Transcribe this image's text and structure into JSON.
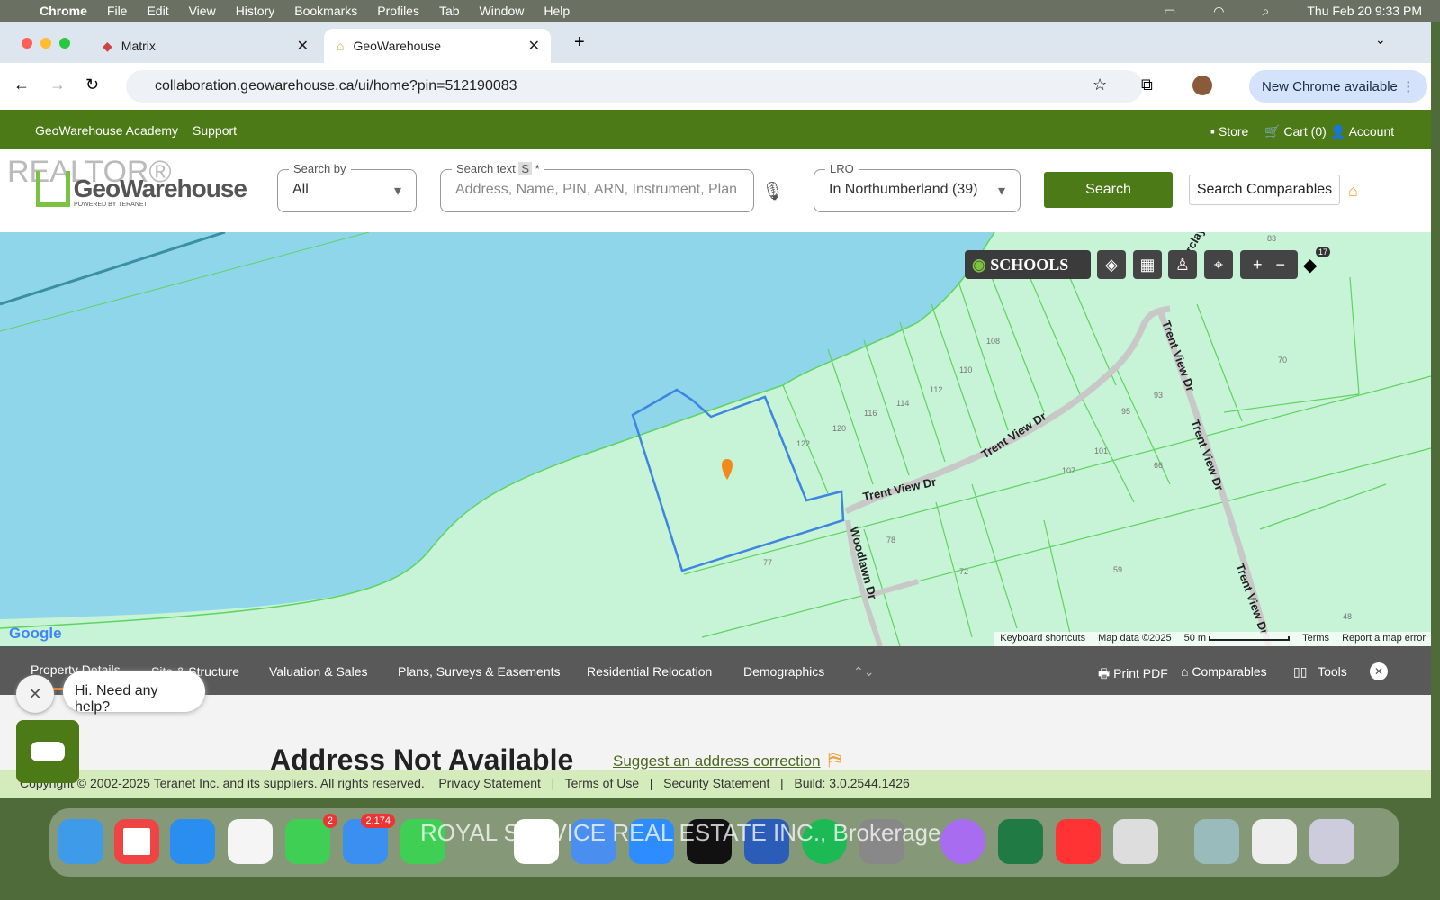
{
  "menubar": {
    "items": [
      "Chrome",
      "File",
      "Edit",
      "View",
      "History",
      "Bookmarks",
      "Profiles",
      "Tab",
      "Window",
      "Help"
    ],
    "datetime": "Thu Feb 20  9:33 PM"
  },
  "browser": {
    "tabs": [
      {
        "label": "Matrix"
      },
      {
        "label": "GeoWarehouse"
      }
    ],
    "url": "collaboration.geowarehouse.ca/ui/home?pin=512190083",
    "new_chrome": "New Chrome available"
  },
  "nav": {
    "left": [
      "GeoWarehouse Academy",
      "Support"
    ],
    "store": "Store",
    "cart": "Cart (0)",
    "account": "Account"
  },
  "header": {
    "logo_text": "GeoWarehouse",
    "logo_sub": "POWERED BY TERANET",
    "watermark": "REALTOR®",
    "search_by": {
      "label": "Search by",
      "value": "All"
    },
    "search_text": {
      "label": "Search text",
      "badge": "S",
      "placeholder": "Address, Name, PIN, ARN, Instrument, Plan"
    },
    "lro": {
      "label": "LRO",
      "value": "In Northumberland (39)"
    },
    "search_button": "Search",
    "comparables_button": "Search Comparables"
  },
  "map": {
    "schools": "SCHOOLS",
    "layer_count": "17",
    "google": "Google",
    "streets": [
      "Trent View Dr",
      "Trent View Dr",
      "Trent View Dr",
      "Trent View Dr",
      "Trent View Dr",
      "Woodlawn Dr",
      "Barclay"
    ],
    "lots": [
      "122",
      "120",
      "116",
      "114",
      "112",
      "110",
      "108",
      "93",
      "95",
      "101",
      "107",
      "66",
      "70",
      "83",
      "78",
      "77",
      "72",
      "59",
      "48"
    ],
    "attribution": [
      "Keyboard shortcuts",
      "Map data ©2025",
      "50 m",
      "Terms",
      "Report a map error"
    ],
    "colors": {
      "water": "#8fd6ea",
      "land": "#c7f3d6",
      "parcel": "#3d86e0",
      "lines": "#5fd35f"
    }
  },
  "property_tabs": [
    "Property Details",
    "Site & Structure",
    "Valuation & Sales",
    "Plans, Surveys & Easements",
    "Residential Relocation",
    "Demographics"
  ],
  "tools": {
    "print": "Print PDF",
    "comparables": "Comparables",
    "tools": "Tools"
  },
  "chat": {
    "message": "Hi. Need any help?"
  },
  "content": {
    "title": "Address Not Available",
    "suggest": "Suggest an address correction"
  },
  "footer": {
    "copyright": "Copyright © 2002-2025 Teranet Inc. and its suppliers. All rights reserved.",
    "links": [
      "Privacy Statement",
      "Terms of Use",
      "Security Statement"
    ],
    "build": "Build: 3.0.2544.1426"
  },
  "dock": {
    "watermark": "ROYAL SERVICE REAL ESTATE INC., Brokerage",
    "messages_badge": "2",
    "mail_badge": "2,174"
  }
}
